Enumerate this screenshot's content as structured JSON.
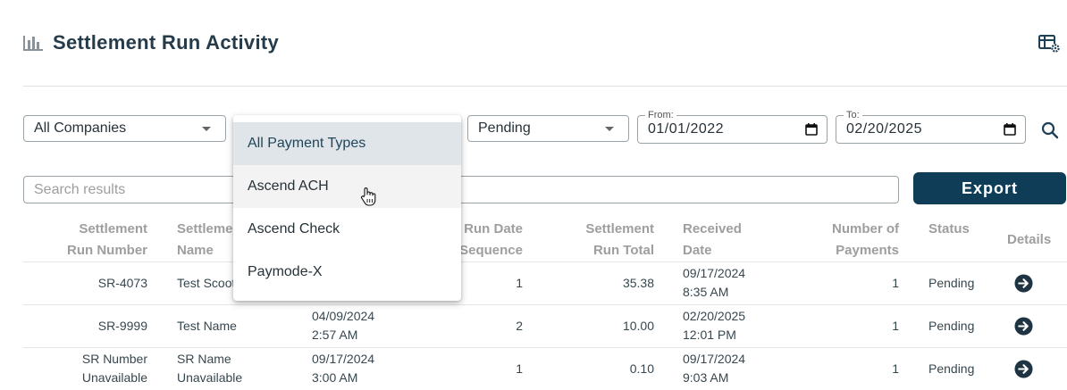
{
  "header": {
    "title": "Settlement Run Activity",
    "title_icon": "bar-chart-icon",
    "settings_icon": "table-settings-icon"
  },
  "filters": {
    "company": "All Companies",
    "status": "Pending",
    "from_label": "From:",
    "from_value": "01/01/2022",
    "to_label": "To:",
    "to_value": "02/20/2025"
  },
  "search": {
    "placeholder": "Search results"
  },
  "export_label": "Export",
  "payment_menu": {
    "items": [
      "All Payment Types",
      "Ascend ACH",
      "Ascend Check",
      "Paymode-X"
    ],
    "selected": "All Payment Types",
    "hovered": "Ascend ACH"
  },
  "table": {
    "headers": {
      "run_number": [
        "Settlement",
        "Run Number"
      ],
      "name": [
        "Settleme",
        "Name"
      ],
      "sequence": [
        "Run Date",
        "Sequence"
      ],
      "total": [
        "Settlement",
        "Run Total"
      ],
      "received": [
        "Received",
        "Date"
      ],
      "payments": [
        "Number of",
        "Payments"
      ],
      "status": "Status",
      "details": "Details"
    },
    "rows": [
      {
        "run_number": [
          "SR-4073"
        ],
        "name": [
          "Test Scoot"
        ],
        "run_date": [],
        "sequence": "1",
        "total": "35.38",
        "received": [
          "09/17/2024",
          "8:35 AM"
        ],
        "payments": "1",
        "status": "Pending"
      },
      {
        "run_number": [
          "SR-9999"
        ],
        "name": [
          "Test Name"
        ],
        "run_date": [
          "04/09/2024",
          "2:57 AM"
        ],
        "sequence": "2",
        "total": "10.00",
        "received": [
          "02/20/2025",
          "12:01 PM"
        ],
        "payments": "1",
        "status": "Pending"
      },
      {
        "run_number": [
          "SR Number",
          "Unavailable"
        ],
        "name": [
          "SR Name",
          "Unavailable"
        ],
        "run_date": [
          "09/17/2024",
          "3:00 AM"
        ],
        "sequence": "1",
        "total": "0.10",
        "received": [
          "09/17/2024",
          "9:03 AM"
        ],
        "payments": "1",
        "status": "Pending"
      }
    ]
  },
  "colors": {
    "accent": "#0f3c56",
    "title": "#263b4a",
    "header_text": "#9e9e9e"
  }
}
